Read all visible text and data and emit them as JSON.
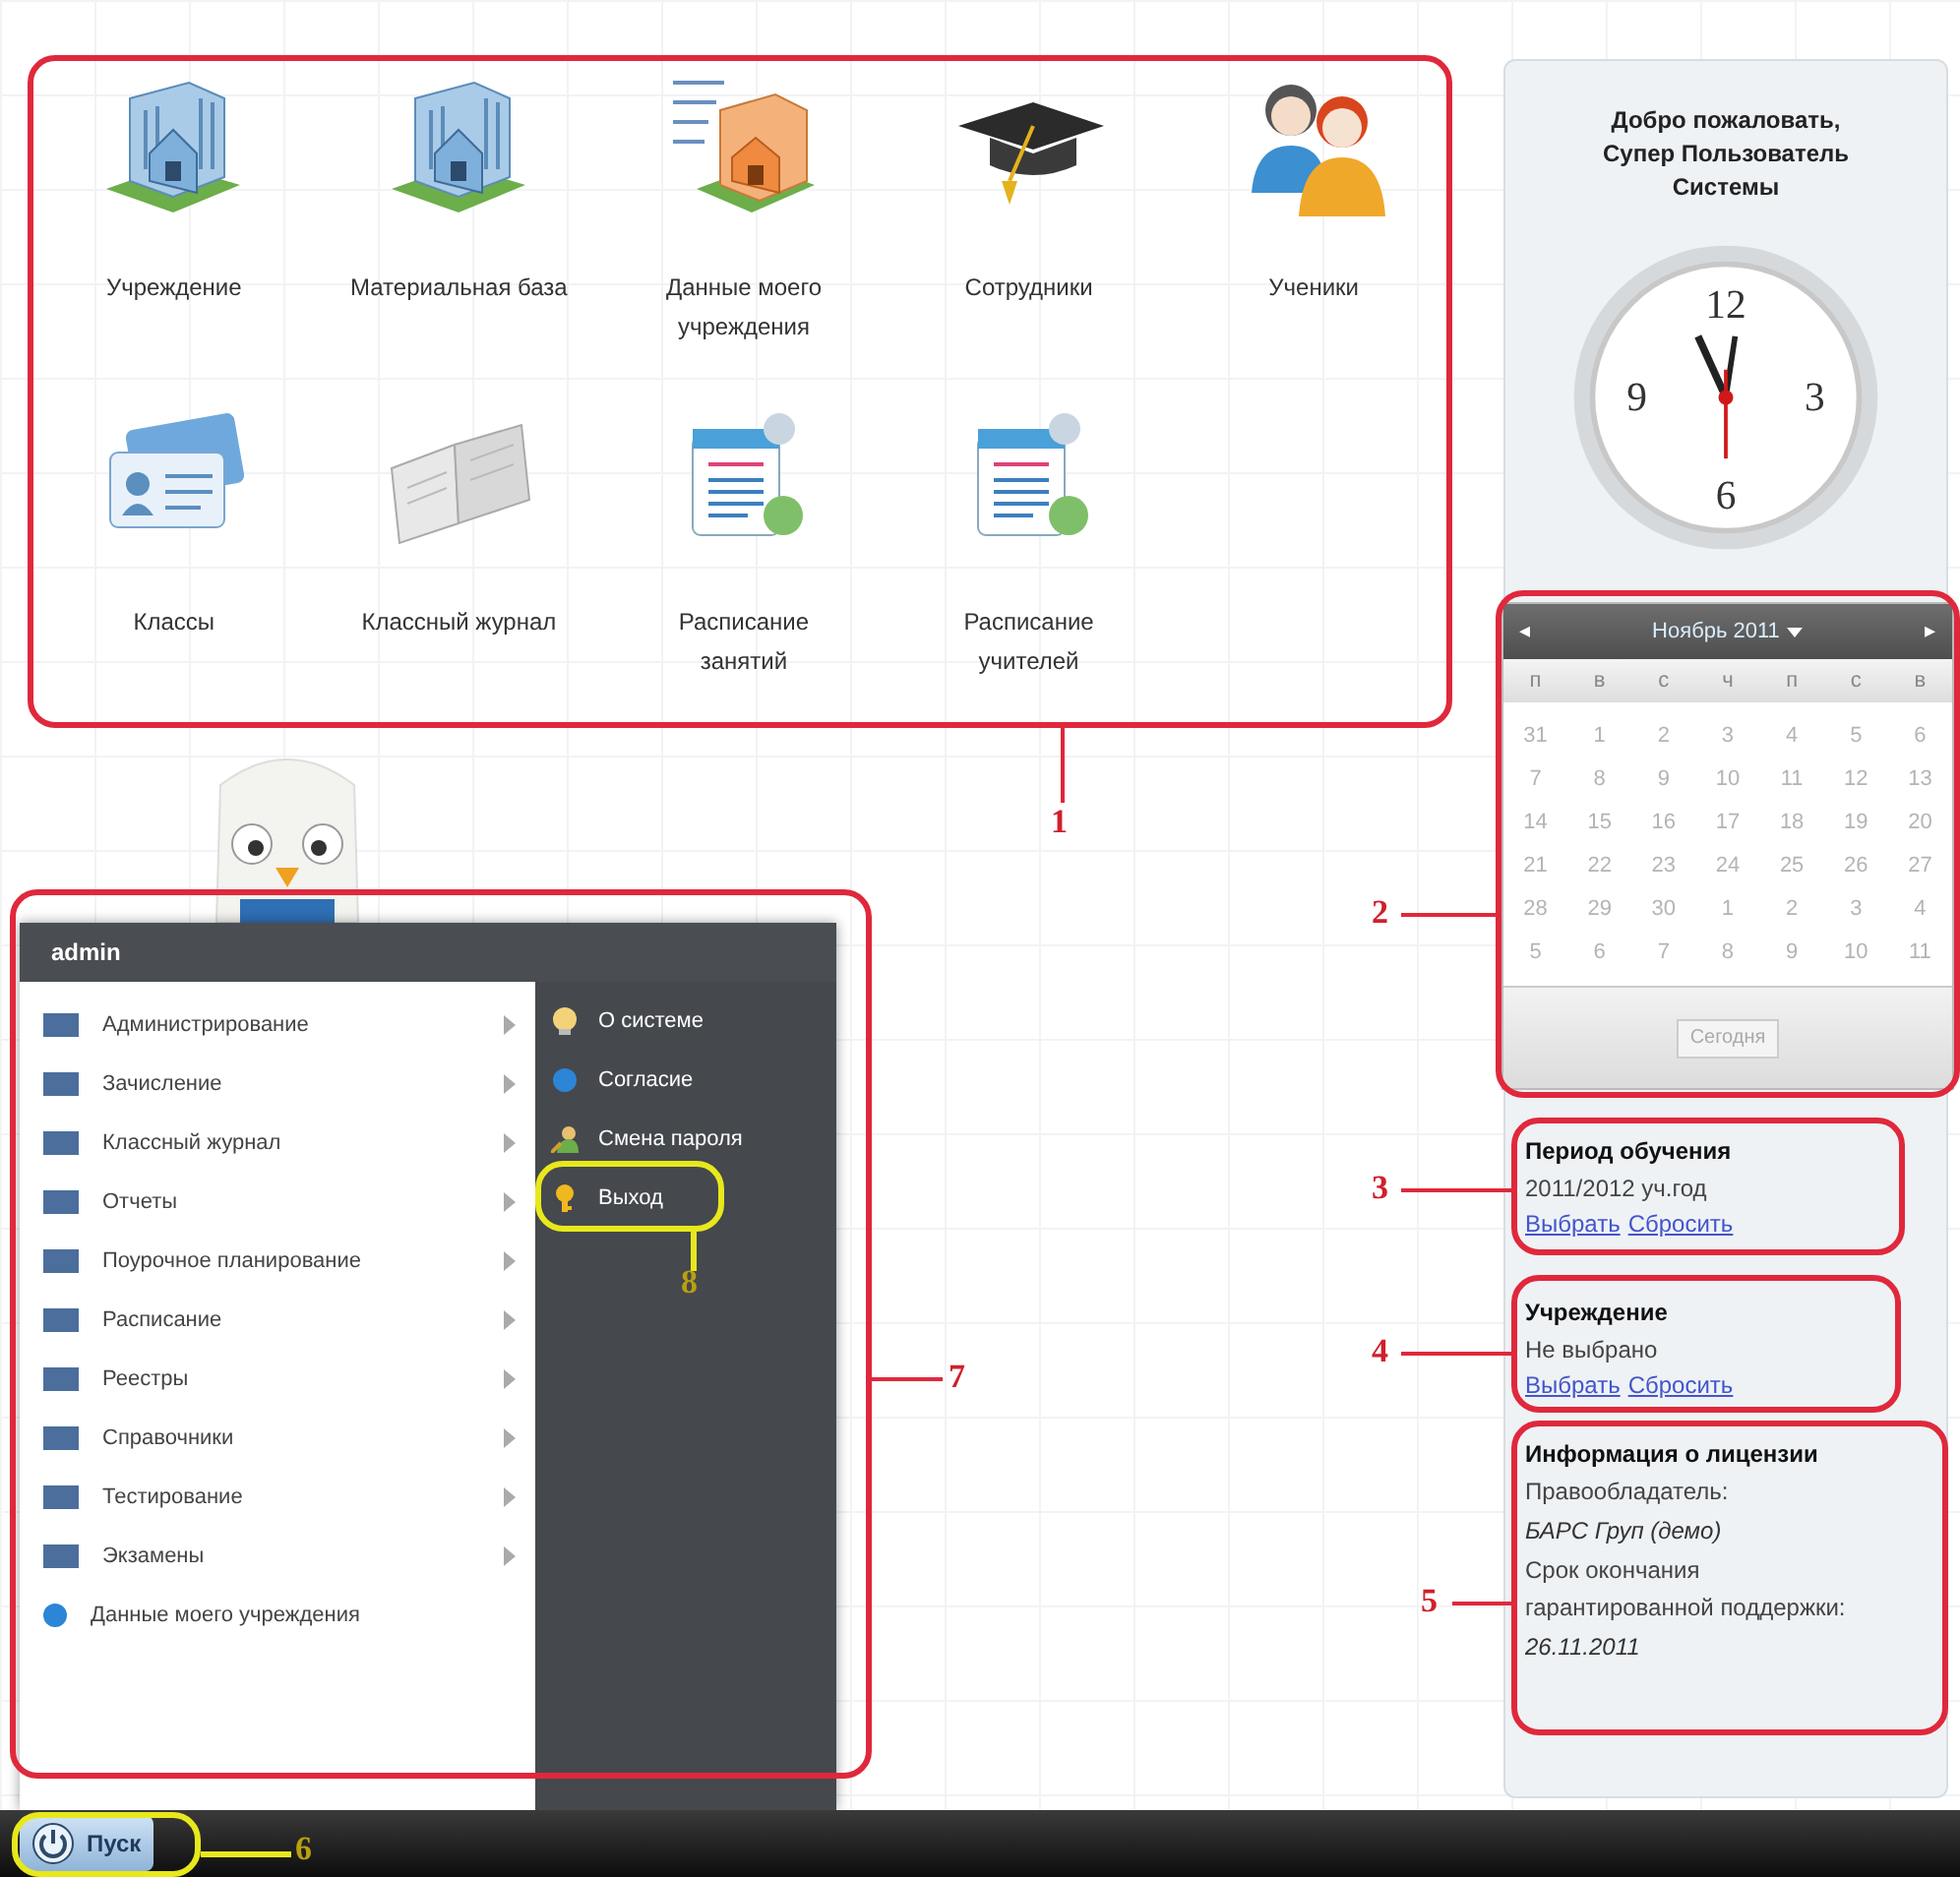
{
  "desktop": {
    "shortcuts": [
      {
        "label": "Учреждение",
        "kind": "building"
      },
      {
        "label": "Материальная база",
        "kind": "building"
      },
      {
        "label": "Данные моего учреждения",
        "kind": "building_orange"
      },
      {
        "label": "Сотрудники",
        "kind": "cap"
      },
      {
        "label": "Ученики",
        "kind": "people"
      },
      {
        "label": "Классы",
        "kind": "cards"
      },
      {
        "label": "Классный журнал",
        "kind": "book"
      },
      {
        "label": "Расписание занятий",
        "kind": "schedule"
      },
      {
        "label": "Расписание учителей",
        "kind": "schedule"
      }
    ]
  },
  "start_menu": {
    "user": "admin",
    "programs": [
      {
        "label": "Администрирование",
        "kind": "folder"
      },
      {
        "label": "Зачисление",
        "kind": "folder"
      },
      {
        "label": "Классный журнал",
        "kind": "folder"
      },
      {
        "label": "Отчеты",
        "kind": "folder"
      },
      {
        "label": "Поурочное планирование",
        "kind": "folder"
      },
      {
        "label": "Расписание",
        "kind": "folder"
      },
      {
        "label": "Реестры",
        "kind": "folder"
      },
      {
        "label": "Справочники",
        "kind": "folder"
      },
      {
        "label": "Тестирование",
        "kind": "folder"
      },
      {
        "label": "Экзамены",
        "kind": "folder"
      },
      {
        "label": "Данные моего учреждения",
        "kind": "link"
      }
    ],
    "links": [
      {
        "label": "О системе",
        "kind": "bulb"
      },
      {
        "label": "Согласие",
        "kind": "globe"
      },
      {
        "label": "Смена пароля",
        "kind": "user_key"
      },
      {
        "label": "Выход",
        "kind": "key"
      }
    ]
  },
  "taskbar": {
    "start_button": "Пуск"
  },
  "sidebar": {
    "welcome": "Добро пожаловать, Супер Пользователь Системы",
    "clock": {
      "numerals": [
        "12",
        "3",
        "6",
        "9"
      ]
    },
    "calendar": {
      "month": "Ноябрь 2011",
      "prev": "◂",
      "next": "▸",
      "weekdays": [
        "п",
        "в",
        "с",
        "ч",
        "п",
        "с",
        "в"
      ],
      "weeks": [
        [
          "31",
          "1",
          "2",
          "3",
          "4",
          "5",
          "6"
        ],
        [
          "7",
          "8",
          "9",
          "10",
          "11",
          "12",
          "13"
        ],
        [
          "14",
          "15",
          "16",
          "17",
          "18",
          "19",
          "20"
        ],
        [
          "21",
          "22",
          "23",
          "24",
          "25",
          "26",
          "27"
        ],
        [
          "28",
          "29",
          "30",
          "1",
          "2",
          "3",
          "4"
        ],
        [
          "5",
          "6",
          "7",
          "8",
          "9",
          "10",
          "11"
        ]
      ],
      "today_button": "Сегодня"
    },
    "panels": [
      {
        "title": "Период обучения",
        "lines": [
          {
            "text": "2011/2012 уч.год",
            "kind": "plain"
          }
        ],
        "links": [
          "Выбрать",
          "Сбросить"
        ]
      },
      {
        "title": "Учреждение",
        "lines": [
          {
            "text": "Не выбрано",
            "kind": "plain"
          }
        ],
        "links": [
          "Выбрать",
          "Сбросить"
        ]
      },
      {
        "title": "Информация о лицензии",
        "lines": [
          {
            "text": "Правообладатель:",
            "kind": "plain"
          },
          {
            "text": "БАРС Груп (демо)",
            "kind": "value"
          },
          {
            "text": "Срок окончания гарантированной поддержки:",
            "kind": "plain"
          },
          {
            "text": "26.11.2011",
            "kind": "value"
          }
        ]
      }
    ]
  },
  "annotations": [
    {
      "label": "1",
      "color": "#e0283c"
    },
    {
      "label": "2",
      "color": "#e0283c"
    },
    {
      "label": "3",
      "color": "#e0283c"
    },
    {
      "label": "4",
      "color": "#e0283c"
    },
    {
      "label": "5",
      "color": "#e0283c"
    },
    {
      "label": "6",
      "color": "#e8e81c"
    },
    {
      "label": "7",
      "color": "#e0283c"
    },
    {
      "label": "8",
      "color": "#e8e81c"
    }
  ]
}
